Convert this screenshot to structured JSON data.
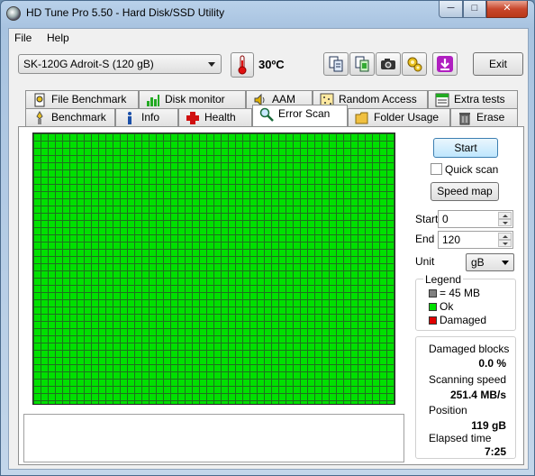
{
  "window": {
    "title": "HD Tune Pro 5.50 - Hard Disk/SSD Utility",
    "minimize": "─",
    "maximize": "□",
    "close": "✕"
  },
  "menu": {
    "file": "File",
    "help": "Help"
  },
  "toolbar": {
    "drive": "SK-120G Adroit-S (120 gB)",
    "temperature": "30ºC",
    "exit_label": "Exit",
    "icons": [
      "thermometer-icon",
      "copy-text-icon",
      "copy-screen-icon",
      "camera-icon",
      "options-icon",
      "save-down-icon"
    ]
  },
  "tabs": {
    "row1": [
      "File Benchmark",
      "Disk monitor",
      "AAM",
      "Random Access",
      "Extra tests"
    ],
    "row2": [
      "Benchmark",
      "Info",
      "Health",
      "Error Scan",
      "Folder Usage",
      "Erase"
    ],
    "active": "Error Scan"
  },
  "scan": {
    "start_label": "Start",
    "quick_scan_label": "Quick scan",
    "quick_scan_checked": false,
    "speed_map_label": "Speed map",
    "start_field_label": "Start",
    "start_value": "0",
    "end_field_label": "End",
    "end_value": "120",
    "unit_label": "Unit",
    "unit_value": "gB",
    "block_status": "all ok"
  },
  "legend": {
    "title": "Legend",
    "block_size": "= 45 MB",
    "ok": "Ok",
    "damaged": "Damaged",
    "colors": {
      "block": "#808080",
      "ok": "#00e000",
      "damaged": "#e00000"
    }
  },
  "stats": {
    "damaged_blocks_label": "Damaged blocks",
    "damaged_blocks_value": "0.0 %",
    "scanning_speed_label": "Scanning speed",
    "scanning_speed_value": "251.4 MB/s",
    "position_label": "Position",
    "position_value": "119 gB",
    "elapsed_label": "Elapsed time",
    "elapsed_value": "7:25"
  }
}
